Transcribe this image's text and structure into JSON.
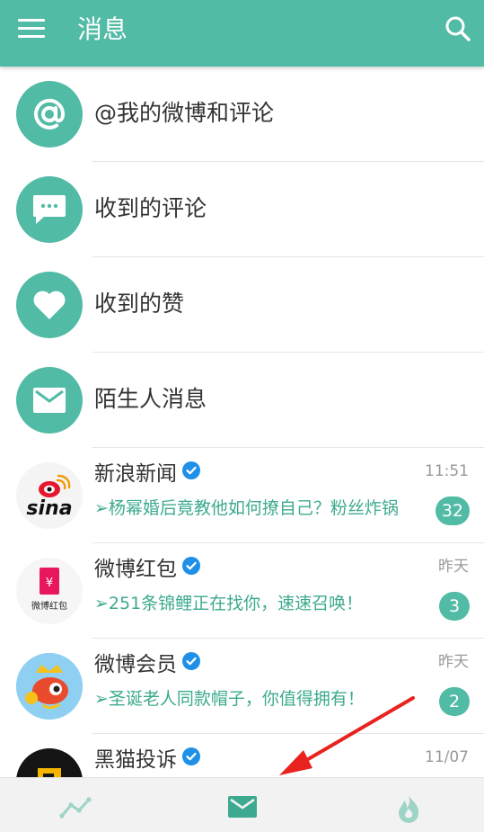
{
  "header": {
    "title": "消息"
  },
  "categories": [
    {
      "label": "@我的微博和评论",
      "icon": "at-icon"
    },
    {
      "label": "收到的评论",
      "icon": "comment-bubble-icon"
    },
    {
      "label": "收到的赞",
      "icon": "heart-icon"
    },
    {
      "label": "陌生人消息",
      "icon": "envelope-icon"
    }
  ],
  "messages": [
    {
      "name": "新浪新闻",
      "time": "11:51",
      "preview": "➢杨幂婚后竟教他如何撩自己？粉丝炸锅",
      "badge": "32",
      "avatar": "sina-logo"
    },
    {
      "name": "微博红包",
      "time": "昨天",
      "preview": "➢251条锦鲤正在找你，速速召唤！",
      "badge": "3",
      "avatar": "red-envelope-logo",
      "avatar_text": "微博红包"
    },
    {
      "name": "微博会员",
      "time": "昨天",
      "preview": "➢圣诞老人同款帽子，你值得拥有！",
      "badge": "2",
      "avatar": "vip-fish-logo"
    },
    {
      "name": "黑猫投诉",
      "time": "11/07",
      "preview": "",
      "badge": "",
      "avatar": "black-cat-logo"
    }
  ],
  "tabs": [
    {
      "name": "trend",
      "icon": "trend-line-icon"
    },
    {
      "name": "messages",
      "icon": "envelope-icon",
      "active": true
    },
    {
      "name": "hot",
      "icon": "flame-icon"
    }
  ],
  "colors": {
    "accent": "#52bba5",
    "preview_text": "#3daa8f",
    "annotation_arrow": "#e8231f"
  }
}
